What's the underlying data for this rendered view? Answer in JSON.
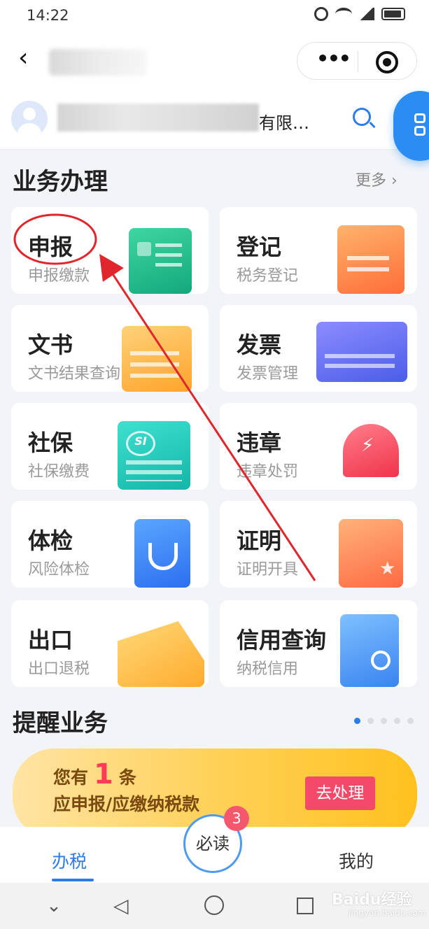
{
  "status_bar": {
    "time": "14:22",
    "network": "4G"
  },
  "company": {
    "name_suffix": "有限…"
  },
  "business": {
    "title": "业务办理",
    "more_label": "更多 ›",
    "cards": [
      {
        "title": "申报",
        "subtitle": "申报缴款"
      },
      {
        "title": "登记",
        "subtitle": "税务登记"
      },
      {
        "title": "文书",
        "subtitle": "文书结果查询"
      },
      {
        "title": "发票",
        "subtitle": "发票管理"
      },
      {
        "title": "社保",
        "subtitle": "社保缴费"
      },
      {
        "title": "违章",
        "subtitle": "违章处罚"
      },
      {
        "title": "体检",
        "subtitle": "风险体检"
      },
      {
        "title": "证明",
        "subtitle": "证明开具"
      },
      {
        "title": "出口",
        "subtitle": "出口退税"
      },
      {
        "title": "信用查询",
        "subtitle": "纳税信用"
      }
    ]
  },
  "reminder": {
    "title": "提醒业务",
    "line1_prefix": "您有",
    "count": "1",
    "line1_suffix": "条",
    "line2": "应申报/应缴纳税款",
    "action_label": "去处理"
  },
  "tab_bar": {
    "tax_label": "办税",
    "must_read_label": "必读",
    "must_read_badge": "3",
    "mine_label": "我的"
  },
  "watermark": {
    "main": "Baidu经验",
    "sub": "jingyan.baidu.com"
  },
  "colors": {
    "accent": "#2b7de9",
    "annotation": "#e0262c"
  }
}
